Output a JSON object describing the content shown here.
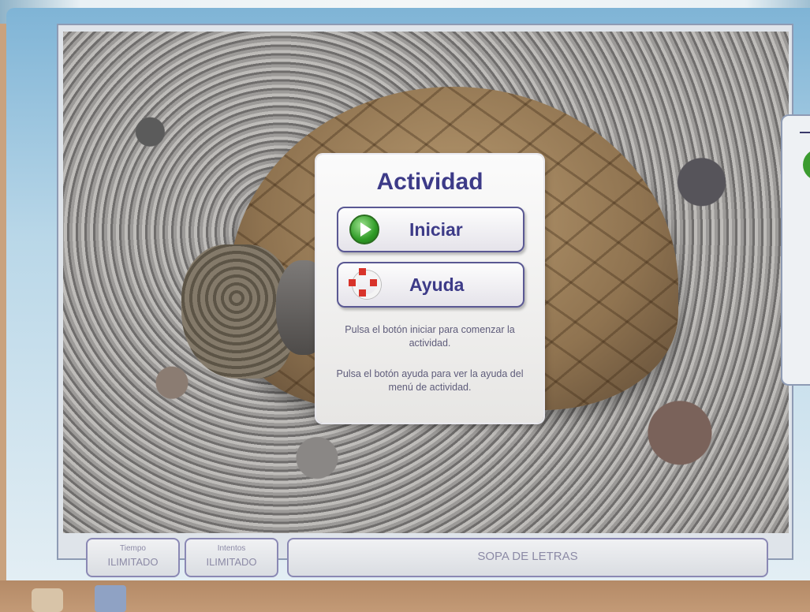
{
  "dialog": {
    "title": "Actividad",
    "start_label": "Iniciar",
    "help_label": "Ayuda",
    "hint_start": "Pulsa el botón iniciar para comenzar la actividad.",
    "hint_help": "Pulsa el botón ayuda para ver la ayuda del menú de actividad."
  },
  "status": {
    "time_label": "Tiempo",
    "time_value": "ILIMITADO",
    "tries_label": "Intentos",
    "tries_value": "ILIMITADO",
    "activity_title": "SOPA DE LETRAS"
  },
  "icons": {
    "start": "play-icon",
    "help": "lifebuoy-icon"
  },
  "colors": {
    "accent": "#3d3b88",
    "play_green": "#2f9b26",
    "help_red": "#d8332a"
  }
}
